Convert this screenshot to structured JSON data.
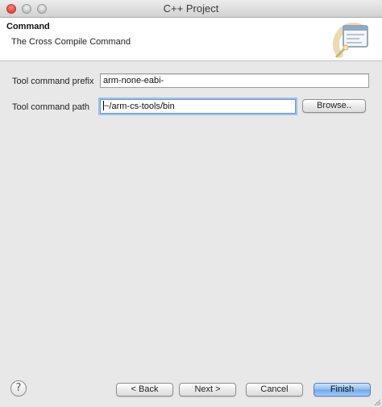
{
  "window": {
    "title": "C++ Project"
  },
  "banner": {
    "heading": "Command",
    "subheading": "The Cross Compile Command",
    "icon": "wizard-banner-icon"
  },
  "form": {
    "prefix": {
      "label": "Tool command prefix",
      "value": "arm-none-eabi-"
    },
    "path": {
      "label": "Tool command path",
      "value": "~/arm-cs-tools/bin",
      "browse_label": "Browse.."
    }
  },
  "footer": {
    "help_icon": "?",
    "back_label": "< Back",
    "next_label": "Next >",
    "cancel_label": "Cancel",
    "finish_label": "Finish"
  },
  "colors": {
    "window_bg": "#e8e8e8",
    "banner_bg": "#ffffff",
    "focus_ring": "#9cc0ee",
    "primary_button": "#8fbcf0"
  }
}
